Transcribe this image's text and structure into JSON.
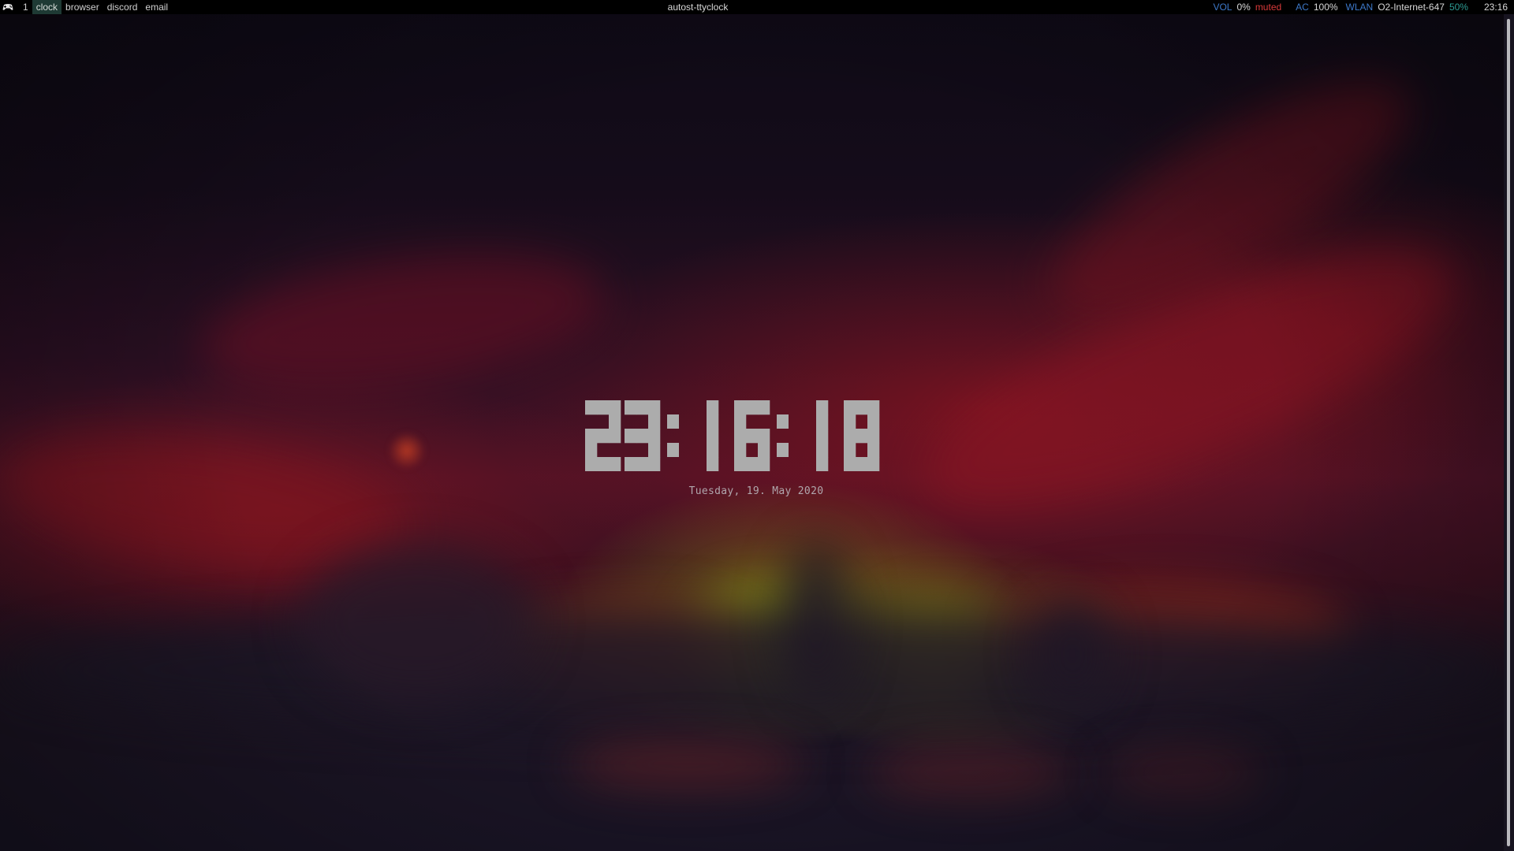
{
  "topbar": {
    "workspaces": [
      {
        "label": "1",
        "active": false
      },
      {
        "label": "clock",
        "active": true
      },
      {
        "label": "browser",
        "active": false
      },
      {
        "label": "discord",
        "active": false
      },
      {
        "label": "email",
        "active": false
      }
    ],
    "window_title": "autost-ttyclock",
    "status": {
      "vol_label": "VOL",
      "vol_value": "0%",
      "vol_state": "muted",
      "ac_label": "AC",
      "ac_value": "100%",
      "wlan_label": "WLAN",
      "wlan_ssid": "O2-Internet-647",
      "wlan_quality": "50%",
      "time": "23:16"
    },
    "icons": {
      "logo": "controller-icon"
    }
  },
  "clock": {
    "time": "23:16:18",
    "date": "Tuesday, 19. May 2020"
  },
  "colors": {
    "bar_bg": "#000000",
    "workspace_active_bg": "#1e3a34",
    "status_label": "#3d78c8",
    "status_muted": "#d83a3a",
    "status_quality": "#2c9b93",
    "clock_digits": "#acacac"
  }
}
